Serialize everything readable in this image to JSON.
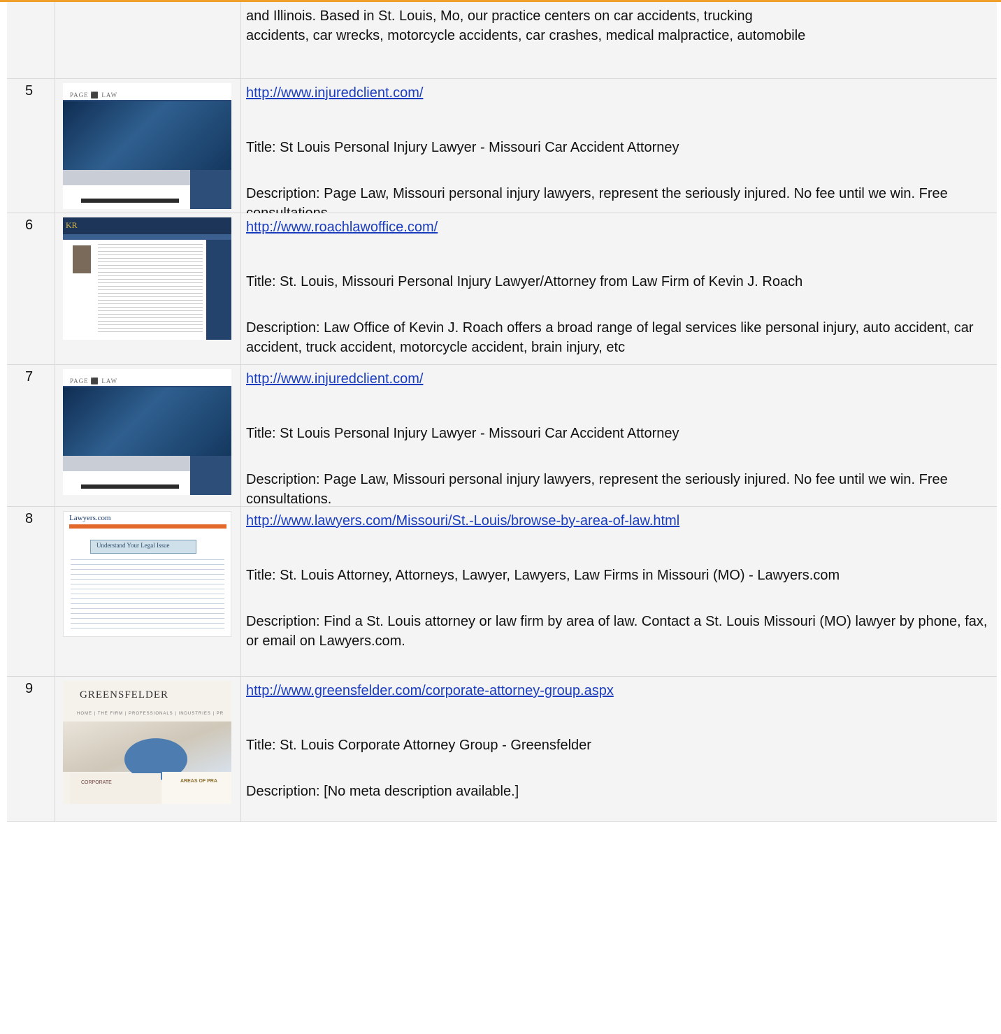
{
  "colors": {
    "accent_bar": "#f0a02a",
    "row_background": "#f4f4f4",
    "link": "#1a3dbf"
  },
  "partial_row": {
    "lines": [
      "and Illinois. Based in St. Louis, Mo, our practice centers on car accidents, trucking",
      "accidents, car wrecks, motorcycle accidents, car crashes, medical malpractice, automobile"
    ]
  },
  "rows": [
    {
      "number": "5",
      "url": "http://www.injuredclient.com/",
      "title": "Title: St Louis Personal Injury Lawyer - Missouri Car Accident Attorney",
      "description": "Description: Page Law, Missouri personal injury lawyers, represent the seriously injured. No fee until we win. Free consultations.",
      "thumbnail": {
        "logo_text": "PAGE ⬛ LAW"
      }
    },
    {
      "number": "6",
      "url": "http://www.roachlawoffice.com/",
      "title": "Title: St. Louis, Missouri Personal Injury Lawyer/Attorney from Law Firm of Kevin J. Roach",
      "description": "Description: Law Office of Kevin J. Roach offers a broad range of legal services like personal injury, auto accident, car accident, truck accident, motorcycle accident, brain injury, etc",
      "thumbnail": {
        "logo_text": "KR"
      }
    },
    {
      "number": "7",
      "url": "http://www.injuredclient.com/",
      "title": "Title: St Louis Personal Injury Lawyer - Missouri Car Accident Attorney",
      "description": "Description: Page Law, Missouri personal injury lawyers, represent the seriously injured. No fee until we win. Free consultations.",
      "thumbnail": {
        "logo_text": "PAGE ⬛ LAW"
      }
    },
    {
      "number": "8",
      "url": "http://www.lawyers.com/Missouri/St.-Louis/browse-by-area-of-law.html",
      "title": "Title: St. Louis Attorney, Attorneys, Lawyer, Lawyers, Law Firms in Missouri (MO) - Lawyers.com",
      "description": "Description: Find a St. Louis attorney or law firm by area of law. Contact a St. Louis Missouri (MO) lawyer by phone, fax, or email on Lawyers.com.",
      "thumbnail": {
        "logo_text": "Lawyers.com",
        "banner_text": "Understand Your Legal Issue"
      }
    },
    {
      "number": "9",
      "url": "http://www.greensfelder.com/corporate-attorney-group.aspx",
      "title": "Title: St. Louis Corporate Attorney Group - Greensfelder",
      "description": "Description: [No meta description available.]",
      "thumbnail": {
        "logo_text": "GREENSFELDER",
        "nav_text": "HOME | THE FIRM | PROFESSIONALS | INDUSTRIES | PR",
        "left_text": "CORPORATE",
        "right_text": "AREAS OF PRA"
      }
    }
  ]
}
